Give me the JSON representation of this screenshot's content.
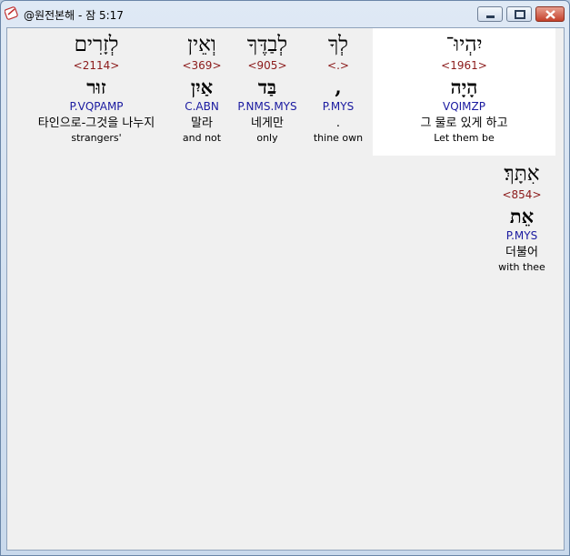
{
  "window": {
    "title": "@원전본해 - 잠 5:17"
  },
  "words": [
    {
      "heb": "יִהְיוּ־",
      "strong": "<1961>",
      "root": "הָיָה",
      "parse": "VQIMZP",
      "kor": "그 물로 있게 하고",
      "eng": "Let them be"
    },
    {
      "heb": "לְךָ",
      "strong": "<.>",
      "root": ",",
      "parse": "P.MYS",
      "kor": ".",
      "eng": "thine own"
    },
    {
      "heb": "לְבַדֶּךָ",
      "strong": "<905>",
      "root": "בַּד",
      "parse": "P.NMS.MYS",
      "kor": "네게만",
      "eng": "only"
    },
    {
      "heb": "וְאֵין",
      "strong": "<369>",
      "root": "אַיִן",
      "parse": "C.ABN",
      "kor": "말라",
      "eng": "and not"
    },
    {
      "heb": "לְזָרִים",
      "strong": "<2114>",
      "root": "זוּר",
      "parse": "P.VQPAMP",
      "kor": "타인으로-그것을 나누지",
      "eng": "strangers'"
    },
    {
      "heb": "אִתָּךְ׃",
      "strong": "<854>",
      "root": "אֵת",
      "parse": "P.MYS",
      "kor": "더불어",
      "eng": "with thee"
    }
  ]
}
